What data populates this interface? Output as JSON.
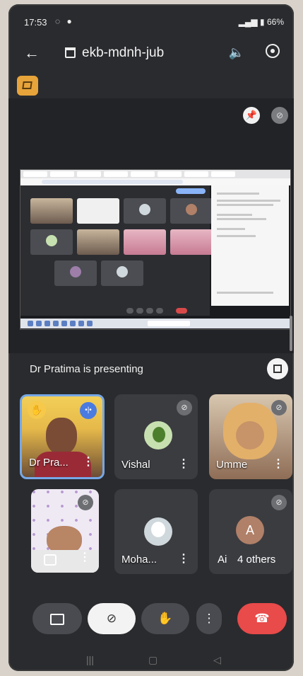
{
  "status_bar": {
    "time": "17:53",
    "battery": "66%"
  },
  "top_bar": {
    "meeting_code": "ekb-mdnh-jub"
  },
  "presentation": {
    "presenting_label": "Dr Pratima is presenting"
  },
  "participants": [
    {
      "name": "Dr Pra...",
      "muted": false,
      "hand_raised": true
    },
    {
      "name": "Vishal",
      "muted": true
    },
    {
      "name": "Umme",
      "muted": true
    },
    {
      "name": "",
      "muted": true
    },
    {
      "name": "Moha...",
      "muted": false
    },
    {
      "name": "Ai",
      "avatar_letter": "A",
      "others_label": "4 others",
      "muted": true
    }
  ],
  "colors": {
    "background": "#2a2b2e",
    "accent": "#76a7e6",
    "end_call": "#e94a4a",
    "cc_badge": "#e7a43a"
  },
  "icons": {
    "back": "arrow-left-icon",
    "calendar": "calendar-icon",
    "speaker": "speaker-icon",
    "switch_camera": "camera-switch-icon",
    "pin": "pin-icon",
    "mic_off": "mic-off-icon",
    "fullscreen": "fullscreen-icon",
    "camera": "camera-icon",
    "hand": "hand-icon",
    "more": "more-vertical-icon",
    "end_call": "phone-end-icon"
  }
}
